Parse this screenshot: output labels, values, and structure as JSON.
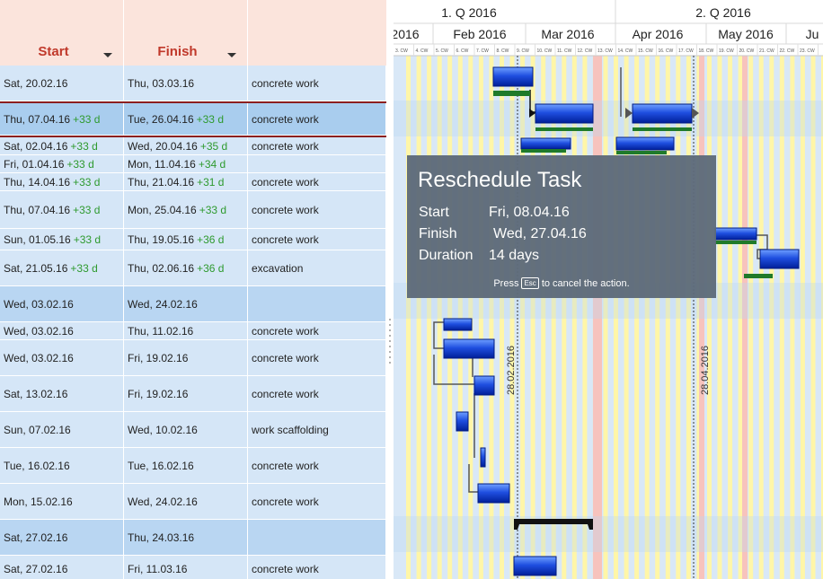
{
  "table": {
    "columns": [
      {
        "label": "Start",
        "sortable": true
      },
      {
        "label": "Finish",
        "sortable": true
      },
      {
        "label": "",
        "sortable": false
      }
    ],
    "rows": [
      {
        "start": "Sat, 20.02.16",
        "start_delta": "",
        "finish": "Thu, 03.03.16",
        "finish_delta": "",
        "desc": "concrete work",
        "kind": "normal"
      },
      {
        "start": "Thu, 07.04.16",
        "start_delta": "+33 d",
        "finish": "Tue, 26.04.16",
        "finish_delta": "+33 d",
        "desc": "concrete work",
        "kind": "selected"
      },
      {
        "start": "Sat, 02.04.16",
        "start_delta": "+33 d",
        "finish": "Wed, 20.04.16",
        "finish_delta": "+35 d",
        "desc": "concrete work",
        "kind": "normal"
      },
      {
        "start": "Fri, 01.04.16",
        "start_delta": "+33 d",
        "finish": "Mon, 11.04.16",
        "finish_delta": "+34 d",
        "desc": "",
        "kind": "normal"
      },
      {
        "start": "Thu, 14.04.16",
        "start_delta": "+33 d",
        "finish": "Thu, 21.04.16",
        "finish_delta": "+31 d",
        "desc": "concrete work",
        "kind": "normal"
      },
      {
        "start": "Thu, 07.04.16",
        "start_delta": "+33 d",
        "finish": "Mon, 25.04.16",
        "finish_delta": "+33 d",
        "desc": "concrete work",
        "kind": "normal"
      },
      {
        "start": "Sun, 01.05.16",
        "start_delta": "+33 d",
        "finish": "Thu, 19.05.16",
        "finish_delta": "+36 d",
        "desc": "concrete work",
        "kind": "normal"
      },
      {
        "start": "Sat, 21.05.16",
        "start_delta": "+33 d",
        "finish": "Thu, 02.06.16",
        "finish_delta": "+36 d",
        "desc": "excavation",
        "kind": "normal"
      },
      {
        "start": "Wed, 03.02.16",
        "start_delta": "",
        "finish": "Wed, 24.02.16",
        "finish_delta": "",
        "desc": "",
        "kind": "summary"
      },
      {
        "start": "Wed, 03.02.16",
        "start_delta": "",
        "finish": "Thu, 11.02.16",
        "finish_delta": "",
        "desc": "concrete work",
        "kind": "normal"
      },
      {
        "start": "Wed, 03.02.16",
        "start_delta": "",
        "finish": "Fri, 19.02.16",
        "finish_delta": "",
        "desc": "concrete work",
        "kind": "normal"
      },
      {
        "start": "Sat, 13.02.16",
        "start_delta": "",
        "finish": "Fri, 19.02.16",
        "finish_delta": "",
        "desc": "concrete work",
        "kind": "normal"
      },
      {
        "start": "Sun, 07.02.16",
        "start_delta": "",
        "finish": "Wed, 10.02.16",
        "finish_delta": "",
        "desc": "work scaffolding",
        "kind": "normal"
      },
      {
        "start": "Tue, 16.02.16",
        "start_delta": "",
        "finish": "Tue, 16.02.16",
        "finish_delta": "",
        "desc": "concrete work",
        "kind": "normal"
      },
      {
        "start": "Mon, 15.02.16",
        "start_delta": "",
        "finish": "Wed, 24.02.16",
        "finish_delta": "",
        "desc": "concrete work",
        "kind": "normal"
      },
      {
        "start": "Sat, 27.02.16",
        "start_delta": "",
        "finish": "Thu, 24.03.16",
        "finish_delta": "",
        "desc": "",
        "kind": "summary"
      },
      {
        "start": "Sat, 27.02.16",
        "start_delta": "",
        "finish": "Fri, 11.03.16",
        "finish_delta": "",
        "desc": "concrete work",
        "kind": "normal"
      }
    ]
  },
  "timeline": {
    "quarters": [
      "1. Q 2016",
      "2. Q 2016"
    ],
    "months": [
      "2016",
      "Feb 2016",
      "Mar 2016",
      "Apr 2016",
      "May 2016",
      "Ju"
    ],
    "weeks": [
      "3. CW",
      "4. CW",
      "5. CW",
      "6. CW",
      "7. CW",
      "8. CW",
      "9. CW",
      "10. CW",
      "11. CW",
      "12. CW",
      "13. CW",
      "14. CW",
      "15. CW",
      "16. CW",
      "17. CW",
      "18. CW",
      "19. CW",
      "20. CW",
      "21. CW",
      "22. CW",
      "23. CW"
    ],
    "marker_lines": [
      "28.02.2016",
      "28.04.2016"
    ]
  },
  "tooltip": {
    "title": "Reschedule Task",
    "start_label": "Start",
    "start_value": "Fri, 08.04.16",
    "finish_label": "Finish",
    "finish_value": "Wed, 27.04.16",
    "duration_label": "Duration",
    "duration_value": "14 days",
    "hint_before": "Press",
    "hint_key": "Esc",
    "hint_after": "to cancel the action."
  },
  "colors": {
    "header_bg": "#fbe4dc",
    "header_text": "#c0392b",
    "row_bg": "#d5e6f7",
    "summary_bg": "#b9d6f2",
    "delta_text": "#2e9a2e",
    "bar_blue": "#0033cc",
    "progress_green": "#1f7a2a",
    "weekend_yellow": "#fff6a8",
    "holiday_pink": "#f7c3bd",
    "tooltip_bg": "#5e6b7a"
  }
}
